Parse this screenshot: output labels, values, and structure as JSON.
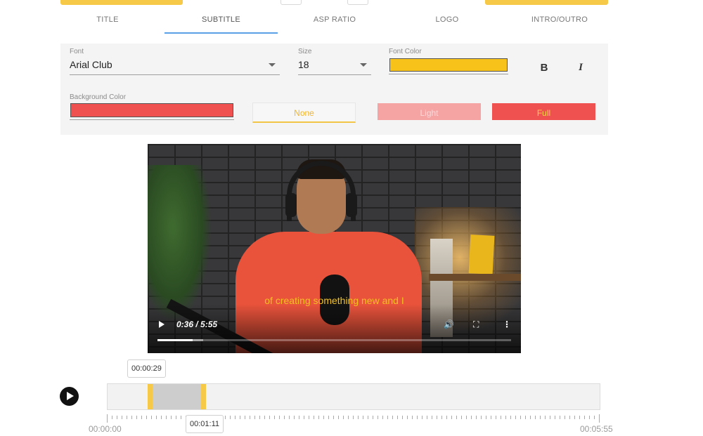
{
  "tabs": [
    "TITLE",
    "SUBTITLE",
    "ASP RATIO",
    "LOGO",
    "INTRO/OUTRO"
  ],
  "active_tab": "SUBTITLE",
  "subtitle_settings": {
    "font_label": "Font",
    "font_value": "Arial Club",
    "size_label": "Size",
    "size_value": "18",
    "font_color_label": "Font Color",
    "font_color": "#f7c21a",
    "bold_label": "B",
    "italic_label": "I",
    "background_color_label": "Background Color",
    "background_color": "#ef5050",
    "background_options": [
      "None",
      "Light",
      "Full"
    ],
    "selected_background_option": "None"
  },
  "colors": {
    "accent_yellow": "#f7c948",
    "tab_underline": "#5aa0e6"
  },
  "video": {
    "subtitle_text": "of creating something new and I",
    "time_display": "0:36 / 5:55",
    "progress": 0.1,
    "buffered": 0.13,
    "controls": [
      "play-icon",
      "volume-icon",
      "fullscreen-icon",
      "more-vert-icon"
    ]
  },
  "timeline": {
    "selection_start_label": "00:00:29",
    "selection_end_label": "00:01:11",
    "start_time": "00:00:00",
    "end_time": "00:05:55",
    "selection_start_seconds": 29,
    "selection_end_seconds": 71,
    "duration_seconds": 355
  }
}
